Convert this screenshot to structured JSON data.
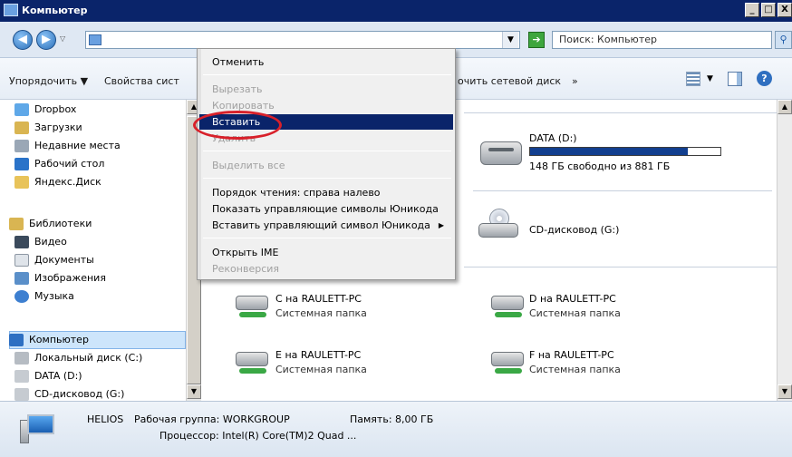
{
  "window": {
    "title": "Компьютер",
    "buttons": [
      "_",
      "□",
      "X"
    ]
  },
  "address": {
    "value": "",
    "search_placeholder": "Поиск: Компьютер"
  },
  "toolbar": {
    "organize": "Упорядочить ▼",
    "system_props": "Свойства сист",
    "map_drive": "очить сетевой диск",
    "more": "»"
  },
  "nav": {
    "favorites": [
      "Dropbox",
      "Загрузки",
      "Недавние места",
      "Рабочий стол",
      "Яндекс.Диск"
    ],
    "libraries_title": "Библиотеки",
    "libraries": [
      "Видео",
      "Документы",
      "Изображения",
      "Музыка"
    ],
    "computer_title": "Компьютер",
    "drives": [
      "Локальный диск (C:)",
      "DATA (D:)",
      "CD-дисковод (G:)"
    ]
  },
  "content": {
    "data_drive": {
      "name": "DATA (D:)",
      "free_text": "148 ГБ свободно из 881 ГБ",
      "used_fraction": 0.83
    },
    "cd_drive": {
      "name": "CD-дисковод (G:)"
    },
    "net_folders": [
      {
        "name": "C на RAULETT-PC",
        "sub": "Системная папка"
      },
      {
        "name": "D на RAULETT-PC",
        "sub": "Системная папка"
      },
      {
        "name": "E на RAULETT-PC",
        "sub": "Системная папка"
      },
      {
        "name": "F на RAULETT-PC",
        "sub": "Системная папка"
      }
    ]
  },
  "details": {
    "name": "HELIOS",
    "workgroup": "Рабочая группа: WORKGROUP",
    "memory": "Память: 8,00 ГБ",
    "processor": "Процессор: Intel(R) Core(TM)2 Quad ..."
  },
  "context_menu": {
    "undo": "Отменить",
    "cut": "Вырезать",
    "copy": "Копировать",
    "paste": "Вставить",
    "delete": "Удалить",
    "select_all": "Выделить все",
    "rtl": "Порядок чтения: справа налево",
    "show_unicode": "Показать управляющие символы Юникода",
    "insert_unicode": "Вставить управляющий символ Юникода",
    "open_ime": "Открыть IME",
    "reconversion": "Реконверсия"
  },
  "colors": {
    "highlight": "#0a246a",
    "annotation": "#d8202a",
    "drive_bar": "#123f8f"
  }
}
